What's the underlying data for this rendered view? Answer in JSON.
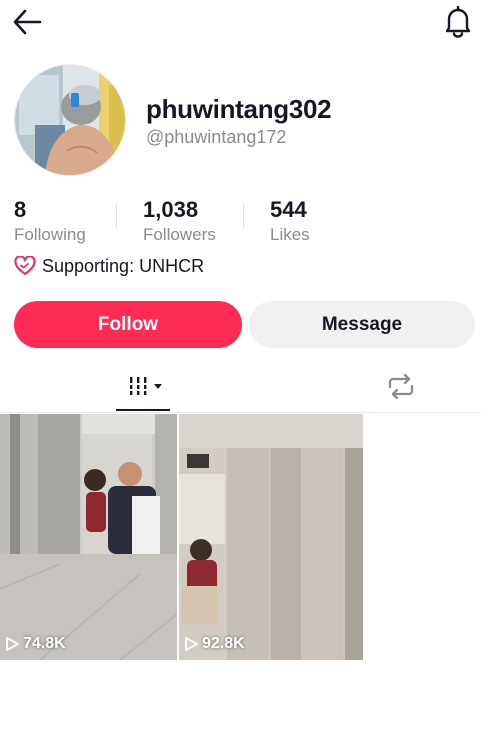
{
  "profile": {
    "username": "phuwintang302",
    "handle": "@phuwintang172",
    "supporting": "Supporting: UNHCR"
  },
  "stats": [
    {
      "value": "8",
      "label": "Following"
    },
    {
      "value": "1,038",
      "label": "Followers"
    },
    {
      "value": "544",
      "label": "Likes"
    }
  ],
  "actions": {
    "follow_label": "Follow",
    "message_label": "Message"
  },
  "tabs": [
    {
      "icon": "video-grid-icon",
      "active": true
    },
    {
      "icon": "repost-icon",
      "active": false
    }
  ],
  "videos": [
    {
      "views": "74.8K"
    },
    {
      "views": "92.8K"
    }
  ],
  "colors": {
    "accent": "#fe2c55",
    "secondary_button": "#f1f1f2",
    "muted_text": "#8a8b91",
    "primary_text": "#161823"
  },
  "icons": [
    "back-arrow-icon",
    "bell-icon",
    "heart-badge-icon",
    "play-icon"
  ]
}
